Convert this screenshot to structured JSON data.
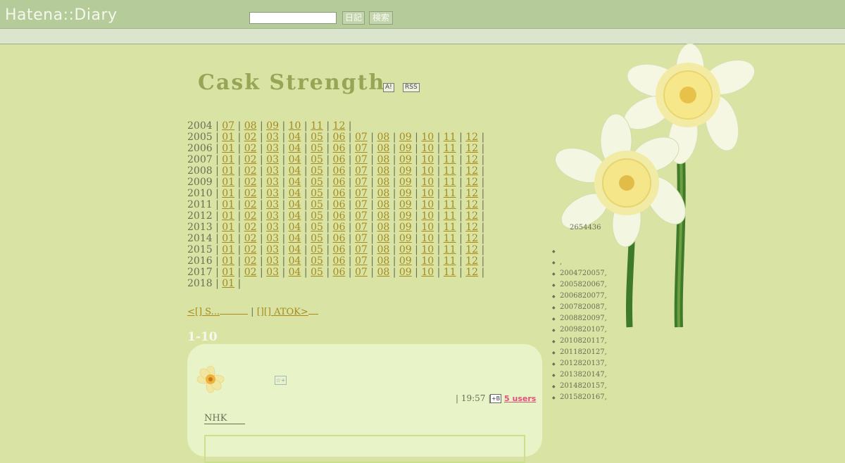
{
  "header": {
    "logo": "Hatena::Diary",
    "search_placeholder": "",
    "diary_button": "日記",
    "search_button": "検索"
  },
  "blog": {
    "title": "Cask Strength",
    "badge_a": "A!",
    "badge_rss": "RSS"
  },
  "archive": [
    {
      "year": "2004",
      "months": [
        "07",
        "08",
        "09",
        "10",
        "11",
        "12"
      ]
    },
    {
      "year": "2005",
      "months": [
        "01",
        "02",
        "03",
        "04",
        "05",
        "06",
        "07",
        "08",
        "09",
        "10",
        "11",
        "12"
      ]
    },
    {
      "year": "2006",
      "months": [
        "01",
        "02",
        "03",
        "04",
        "05",
        "06",
        "07",
        "08",
        "09",
        "10",
        "11",
        "12"
      ]
    },
    {
      "year": "2007",
      "months": [
        "01",
        "02",
        "03",
        "04",
        "05",
        "06",
        "07",
        "08",
        "09",
        "10",
        "11",
        "12"
      ]
    },
    {
      "year": "2008",
      "months": [
        "01",
        "02",
        "03",
        "04",
        "05",
        "06",
        "07",
        "08",
        "09",
        "10",
        "11",
        "12"
      ]
    },
    {
      "year": "2009",
      "months": [
        "01",
        "02",
        "03",
        "04",
        "05",
        "06",
        "07",
        "08",
        "09",
        "10",
        "11",
        "12"
      ]
    },
    {
      "year": "2010",
      "months": [
        "01",
        "02",
        "03",
        "04",
        "05",
        "06",
        "07",
        "08",
        "09",
        "10",
        "11",
        "12"
      ]
    },
    {
      "year": "2011",
      "months": [
        "01",
        "02",
        "03",
        "04",
        "05",
        "06",
        "07",
        "08",
        "09",
        "10",
        "11",
        "12"
      ]
    },
    {
      "year": "2012",
      "months": [
        "01",
        "02",
        "03",
        "04",
        "05",
        "06",
        "07",
        "08",
        "09",
        "10",
        "11",
        "12"
      ]
    },
    {
      "year": "2013",
      "months": [
        "01",
        "02",
        "03",
        "04",
        "05",
        "06",
        "07",
        "08",
        "09",
        "10",
        "11",
        "12"
      ]
    },
    {
      "year": "2014",
      "months": [
        "01",
        "02",
        "03",
        "04",
        "05",
        "06",
        "07",
        "08",
        "09",
        "10",
        "11",
        "12"
      ]
    },
    {
      "year": "2015",
      "months": [
        "01",
        "02",
        "03",
        "04",
        "05",
        "06",
        "07",
        "08",
        "09",
        "10",
        "11",
        "12"
      ]
    },
    {
      "year": "2016",
      "months": [
        "01",
        "02",
        "03",
        "04",
        "05",
        "06",
        "07",
        "08",
        "09",
        "10",
        "11",
        "12"
      ]
    },
    {
      "year": "2017",
      "months": [
        "01",
        "02",
        "03",
        "04",
        "05",
        "06",
        "07",
        "08",
        "09",
        "10",
        "11",
        "12"
      ]
    },
    {
      "year": "2018",
      "months": [
        "01"
      ]
    }
  ],
  "nav": {
    "prev_label": "<[] S...",
    "separator": "|",
    "next_label": "[][] ATOK>"
  },
  "entries_range": "1-10",
  "entry": {
    "star_label": "☆+",
    "time": "| 19:57 |",
    "bookmark_icon": "+B",
    "users": "5 users",
    "body_link": "NHK"
  },
  "sidebar": {
    "count": "2654436",
    "items": [
      "",
      ",",
      "2004720057,",
      "2005820067,",
      "2006820077,",
      "2007820087,",
      "2008820097,",
      "2009820107,",
      "2010820117,",
      "2011820127,",
      "2012820137,",
      "2013820147,",
      "2014820157,",
      "2015820167,"
    ]
  },
  "colors": {
    "background": "#d8e3a4",
    "topbar": "#b5cb9a",
    "title": "#97a656",
    "link": "#a88a1a",
    "users": "#e0507a"
  }
}
